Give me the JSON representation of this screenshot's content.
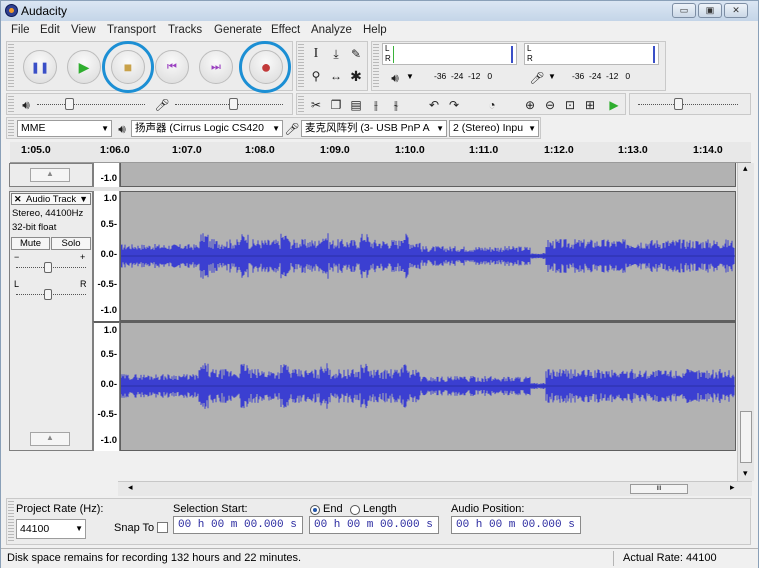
{
  "window": {
    "title": "Audacity",
    "minimize": "▭",
    "maximize": "▣",
    "close": "✕"
  },
  "menu": [
    "File",
    "Edit",
    "View",
    "Transport",
    "Tracks",
    "Generate",
    "Effect",
    "Analyze",
    "Help"
  ],
  "transport": {
    "pause": "❚❚",
    "play": "▶",
    "stop": "■",
    "skip_start": "⏮",
    "skip_end": "⏭",
    "record": "●"
  },
  "tools": {
    "select": "I",
    "envelope": "⤓",
    "draw": "✎",
    "zoom": "⚲",
    "timeshift": "↔",
    "multi": "✱"
  },
  "meters": {
    "play_L": "L",
    "play_R": "R",
    "rec_L": "L",
    "rec_R": "R",
    "scale_play": "-36  -24  -12   0",
    "scale_rec": "-36  -24  -12   0"
  },
  "device": {
    "host": "MME",
    "output": "扬声器 (Cirrus Logic CS420",
    "input": "麦克风阵列 (3- USB PnP A",
    "channels": "2 (Stereo) Inpu"
  },
  "ruler": [
    "1:05.0",
    "1:06.0",
    "1:07.0",
    "1:08.0",
    "1:09.0",
    "1:10.0",
    "1:11.0",
    "1:12.0",
    "1:13.0",
    "1:14.0"
  ],
  "track": {
    "name": "Audio Track",
    "close": "✕",
    "menu": "▼",
    "info1": "Stereo, 44100Hz",
    "info2": "32-bit float",
    "mute": "Mute",
    "solo": "Solo",
    "gain_minus": "−",
    "gain_plus": "+",
    "pan_l": "L",
    "pan_r": "R",
    "collapse": "▲"
  },
  "vscale_top": [
    "-1.0"
  ],
  "vscale": [
    "1.0",
    "0.5-",
    "0.0-",
    "-0.5-",
    "-1.0"
  ],
  "scroll": {
    "left": "◂",
    "right": "▸",
    "up": "▴",
    "down": "▾",
    "thumb": "III"
  },
  "bottom": {
    "rate_label": "Project Rate (Hz):",
    "rate_value": "44100",
    "snap_label": "Snap To",
    "sel_start_label": "Selection Start:",
    "end_label": "End",
    "length_label": "Length",
    "sel_start": "00 h 00 m 00.000 s",
    "sel_end": "00 h 00 m 00.000 s",
    "audio_pos_label": "Audio Position:",
    "audio_pos": "00 h 00 m 00.000 s"
  },
  "status": {
    "left": "Disk space remains for recording 132 hours and 22 minutes.",
    "right": "Actual Rate: 44100"
  },
  "colors": {
    "wave": "#3b3fd1",
    "wave_bg": "#b2b2b2",
    "highlight": "#1c8fd4"
  }
}
